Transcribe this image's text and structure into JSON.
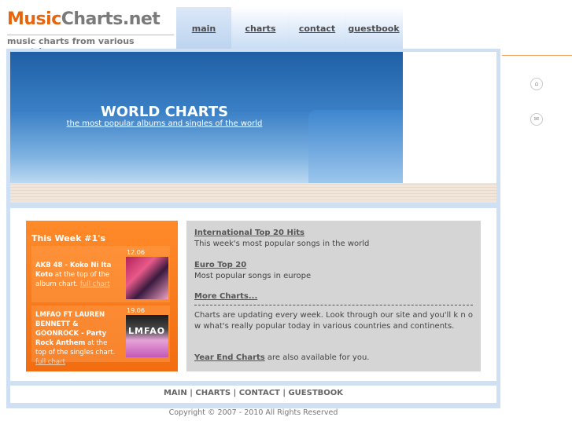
{
  "header": {
    "logo_part1": "Music",
    "logo_part2": "Charts.net",
    "tagline": "music charts from various countries"
  },
  "nav": {
    "items": [
      "main",
      "charts",
      "contact",
      "guestbook"
    ]
  },
  "side_icons": [
    "home-icon",
    "mail-icon"
  ],
  "banner": {
    "title": "WORLD CHARTS",
    "subtitle": "the most popular albums and singles of the world"
  },
  "week": {
    "title": "This Week #1's",
    "entries": [
      {
        "date": "12.06",
        "artist": "AKB 48 - Koko Ni Ita Koto",
        "text": " at the top of the album chart. ",
        "link": "full chart"
      },
      {
        "date": "19.06",
        "artist": "LMFAO FT LAUREN BENNETT & GOONROCK - Party Rock Anthem",
        "text": " at the top of the singles chart. ",
        "link": "full chart"
      }
    ],
    "thumb2_text": "LMFAO"
  },
  "info": {
    "intl_link": "International Top 20 Hits",
    "intl_desc": "This week's most popular songs in the world",
    "euro_link": "Euro Top 20",
    "euro_desc": "Most popular songs in europe",
    "more_link": "More Charts...",
    "paragraph": "Charts are updating every week. Look through our site and you'll k n o w what's really popular today in various countries and continents.",
    "yearend_link": "Year End Charts",
    "yearend_text": " are also available for you."
  },
  "footer": {
    "nav": "MAIN | CHARTS | CONTACT | GUESTBOOK",
    "copyright": "Copyright © 2007 - 2010 All Rights Reserved"
  },
  "colors": {
    "accent": "#e8650c",
    "banner_blue": "#1f5fa6",
    "frame": "#cfe0f4"
  }
}
